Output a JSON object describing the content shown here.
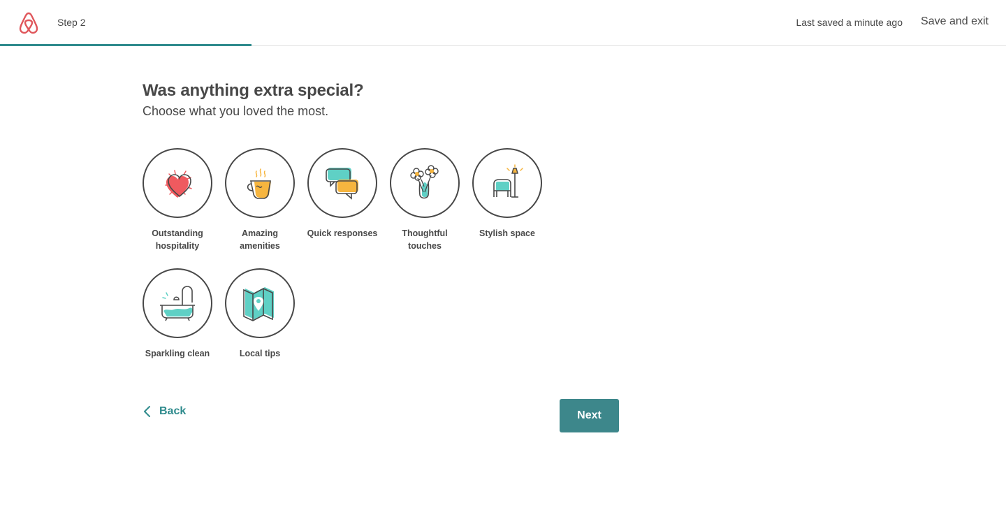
{
  "header": {
    "step_label": "Step 2",
    "last_saved": "Last saved a minute ago",
    "save_exit_label": "Save and exit",
    "progress_fraction": 0.25,
    "logo_icon": "airbnb-logo-icon"
  },
  "main": {
    "title": "Was anything extra special?",
    "subtitle": "Choose what you loved the most.",
    "options": [
      {
        "label": "Outstanding hospitality",
        "icon": "heart-icon"
      },
      {
        "label": "Amazing amenities",
        "icon": "coffee-cup-icon"
      },
      {
        "label": "Quick responses",
        "icon": "chat-bubbles-icon"
      },
      {
        "label": "Thoughtful touches",
        "icon": "flowers-vase-icon"
      },
      {
        "label": "Stylish space",
        "icon": "armchair-lamp-icon"
      },
      {
        "label": "Sparkling clean",
        "icon": "bathtub-icon"
      },
      {
        "label": "Local tips",
        "icon": "map-pin-icon"
      }
    ]
  },
  "footer": {
    "back_label": "Back",
    "next_label": "Next"
  },
  "colors": {
    "accent": "#3d878b",
    "heart": "#ef5a5f",
    "teal": "#5fd0c5",
    "gold": "#f6b53f",
    "text": "#484848",
    "brand": "#e0565b"
  }
}
